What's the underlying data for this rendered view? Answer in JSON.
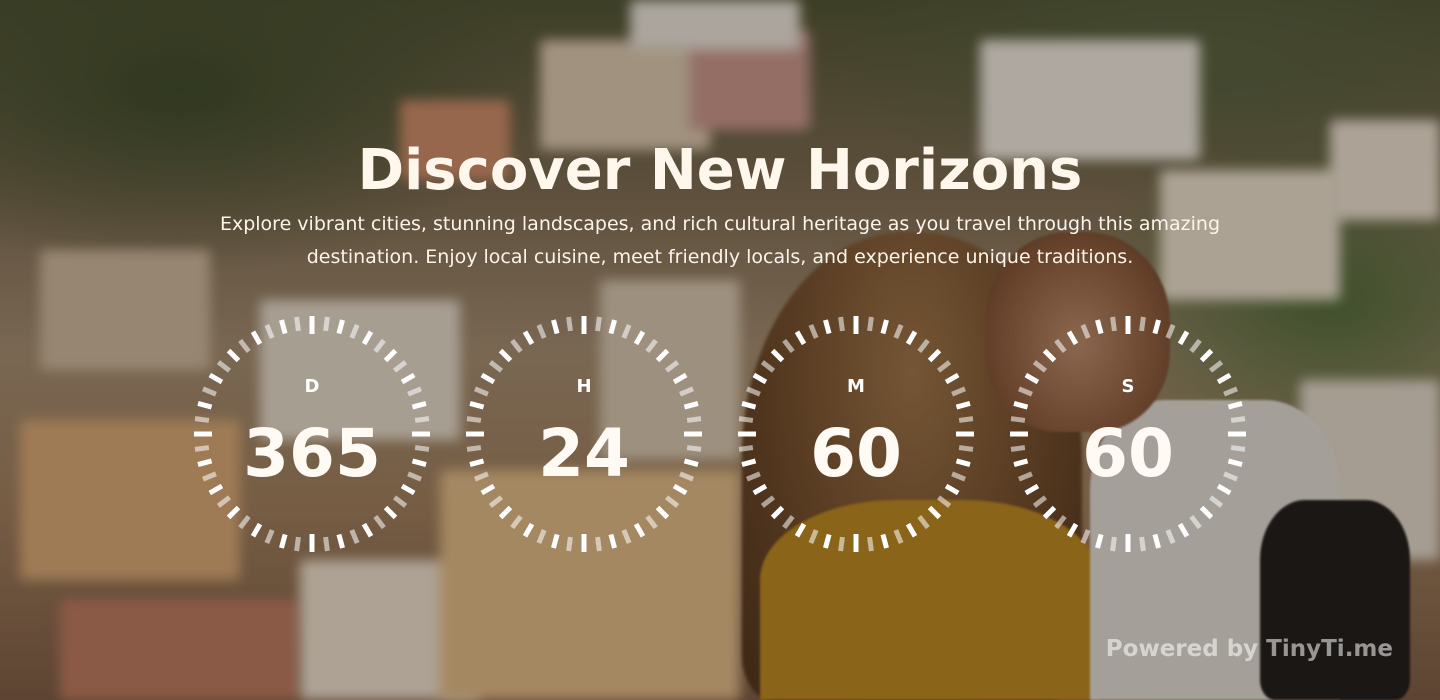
{
  "hero": {
    "title": "Discover New Horizons",
    "subtitle_line1": "Explore vibrant cities, stunning landscapes, and rich cultural heritage as you travel through this amazing",
    "subtitle_line2": "destination. Enjoy local cuisine, meet friendly locals, and experience unique traditions."
  },
  "countdown": {
    "units": [
      {
        "label": "D",
        "value": "365"
      },
      {
        "label": "H",
        "value": "24"
      },
      {
        "label": "M",
        "value": "60"
      },
      {
        "label": "S",
        "value": "60"
      }
    ]
  },
  "footer": {
    "powered_by": "Powered by TinyTi.me"
  },
  "colors": {
    "text": "#ffffff",
    "tick": "#ffffff",
    "tick_faded": "rgba(255,255,255,0.55)"
  }
}
